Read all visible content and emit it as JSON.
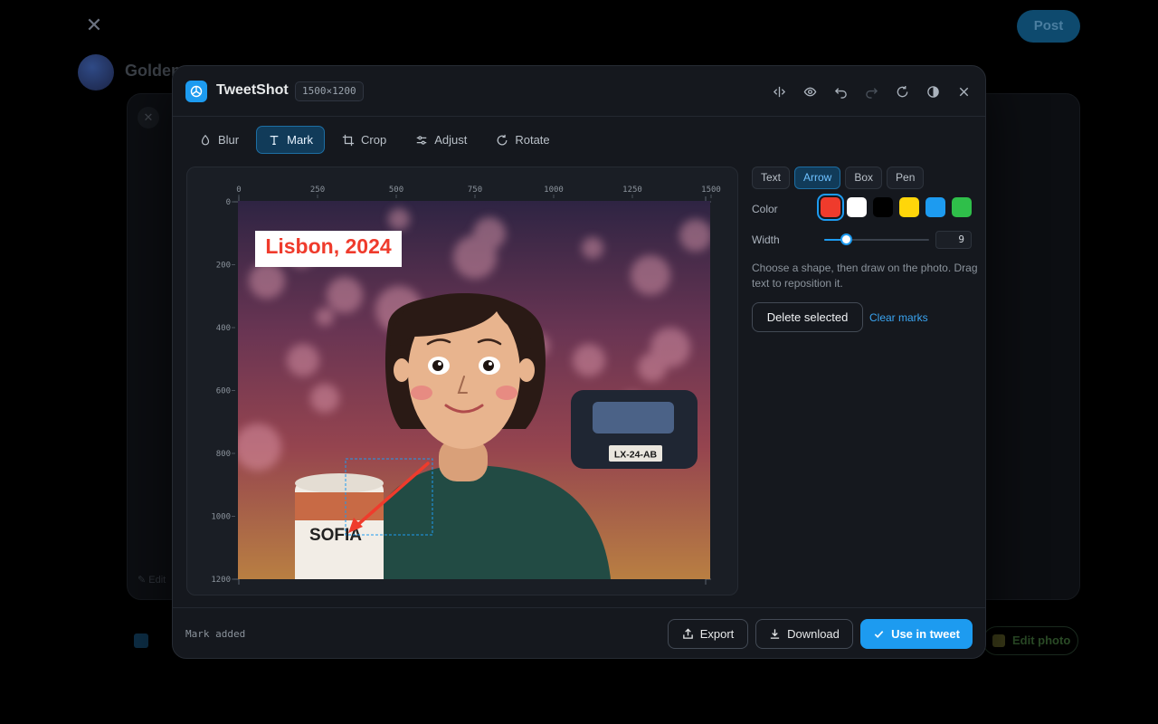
{
  "background": {
    "close_glyph": "✕",
    "post_label": "Post",
    "author_name": "Golden",
    "edit_label": "✎ Edit",
    "edit_photo_label": "Edit photo"
  },
  "header": {
    "title": "TweetShot",
    "dimensions": "1500×1200",
    "icons": [
      "compare-icon",
      "preview-icon",
      "undo-icon",
      "redo-icon",
      "reset-icon",
      "contrast-icon",
      "close-icon"
    ]
  },
  "toolbar": {
    "blur": "Blur",
    "mark": "Mark",
    "crop": "Crop",
    "adjust": "Adjust",
    "rotate": "Rotate",
    "active": "Mark"
  },
  "ruler": {
    "x_ticks": [
      "0",
      "250",
      "500",
      "750",
      "1000",
      "1250",
      "1500"
    ],
    "y_ticks": [
      "0",
      "200",
      "400",
      "600",
      "800",
      "1000",
      "1200"
    ]
  },
  "photo": {
    "caption_text": "Lisbon, 2024",
    "caption_color": "#ef3b2c",
    "plate_text": "LX-24-AB",
    "cup_text": "SOFIA",
    "arrow_color": "#ef3b2c"
  },
  "marks": {
    "shapes": [
      "Text",
      "Arrow",
      "Box",
      "Pen"
    ],
    "active_shape": "Arrow",
    "color_label": "Color",
    "colors": [
      "#ef3b2c",
      "#ffffff",
      "#000000",
      "#ffd60a",
      "#1d9bf0",
      "#2fbf4a"
    ],
    "selected_color": "#ef3b2c",
    "width_label": "Width",
    "width_value": "9",
    "width_min": 1,
    "width_max": 40,
    "hint": "Choose a shape, then draw on the photo. Drag text to reposition it.",
    "delete_label": "Delete selected",
    "clear_label": "Clear marks"
  },
  "footer": {
    "status": "Mark added",
    "export_label": "Export",
    "download_label": "Download",
    "use_label": "Use in tweet"
  }
}
